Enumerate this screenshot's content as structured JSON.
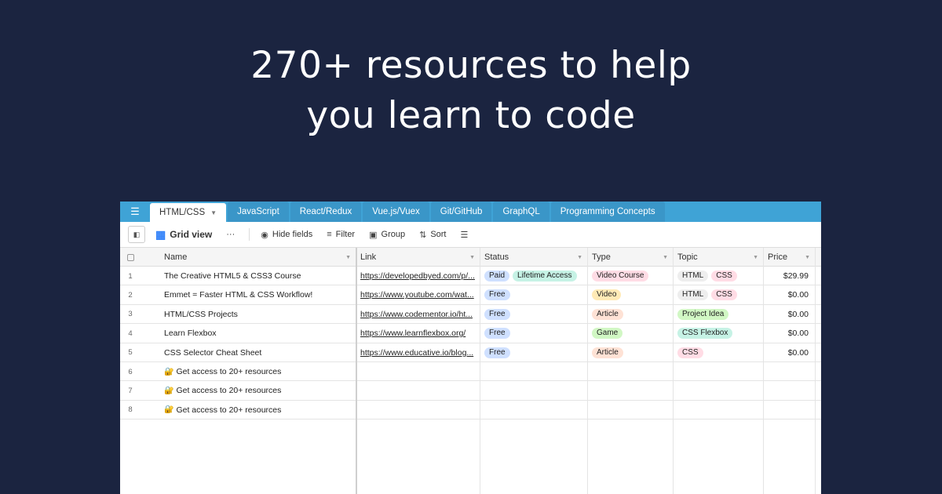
{
  "headline": {
    "line1": "270+ resources to help",
    "line2": "you learn to code"
  },
  "tabs": [
    {
      "label": "HTML/CSS",
      "active": true
    },
    {
      "label": "JavaScript"
    },
    {
      "label": "React/Redux"
    },
    {
      "label": "Vue.js/Vuex"
    },
    {
      "label": "Git/GitHub"
    },
    {
      "label": "GraphQL"
    },
    {
      "label": "Programming Concepts"
    }
  ],
  "toolbar": {
    "view_label": "Grid view",
    "more": "···",
    "hide_fields": "Hide fields",
    "filter": "Filter",
    "group": "Group",
    "sort": "Sort"
  },
  "columns": {
    "name": "Name",
    "link": "Link",
    "status": "Status",
    "type": "Type",
    "topic": "Topic",
    "price": "Price"
  },
  "rows": [
    {
      "num": "1",
      "name": "The Creative HTML5 & CSS3 Course",
      "link": "https://developedbyed.com/p/...",
      "status": [
        {
          "text": "Paid",
          "color": "#cfe0ff"
        },
        {
          "text": "Lifetime Access",
          "color": "#c6f2e5"
        }
      ],
      "type": [
        {
          "text": "Video Course",
          "color": "#ffdce5"
        }
      ],
      "topic": [
        {
          "text": "HTML",
          "color": "#eeeeee"
        },
        {
          "text": "CSS",
          "color": "#ffdce5"
        }
      ],
      "price": "$29.99"
    },
    {
      "num": "2",
      "name": "Emmet = Faster HTML & CSS Workflow!",
      "link": "https://www.youtube.com/wat...",
      "status": [
        {
          "text": "Free",
          "color": "#cfe0ff"
        }
      ],
      "type": [
        {
          "text": "Video",
          "color": "#ffeab6"
        }
      ],
      "topic": [
        {
          "text": "HTML",
          "color": "#eeeeee"
        },
        {
          "text": "CSS",
          "color": "#ffdce5"
        }
      ],
      "price": "$0.00"
    },
    {
      "num": "3",
      "name": "HTML/CSS Projects",
      "link": "https://www.codementor.io/ht...",
      "status": [
        {
          "text": "Free",
          "color": "#cfe0ff"
        }
      ],
      "type": [
        {
          "text": "Article",
          "color": "#fee2d5"
        }
      ],
      "topic": [
        {
          "text": "Project Idea",
          "color": "#d1f7c4"
        }
      ],
      "price": "$0.00"
    },
    {
      "num": "4",
      "name": "Learn Flexbox",
      "link": "https://www.learnflexbox.org/",
      "status": [
        {
          "text": "Free",
          "color": "#cfe0ff"
        }
      ],
      "type": [
        {
          "text": "Game",
          "color": "#d1f7c4"
        }
      ],
      "topic": [
        {
          "text": "CSS Flexbox",
          "color": "#c6f2e5"
        }
      ],
      "price": "$0.00"
    },
    {
      "num": "5",
      "name": "CSS Selector Cheat Sheet",
      "link": "https://www.educative.io/blog...",
      "status": [
        {
          "text": "Free",
          "color": "#cfe0ff"
        }
      ],
      "type": [
        {
          "text": "Article",
          "color": "#fee2d5"
        }
      ],
      "topic": [
        {
          "text": "CSS",
          "color": "#ffdce5"
        }
      ],
      "price": "$0.00"
    },
    {
      "num": "6",
      "name": "Get access to 20+ resources",
      "locked": true
    },
    {
      "num": "7",
      "name": "Get access to 20+ resources",
      "locked": true
    },
    {
      "num": "8",
      "name": "Get access to 20+ resources",
      "locked": true
    }
  ],
  "colors": {
    "background": "#1b2440",
    "tabbar": "#3fa3d6",
    "grid_icon": "#2d7ff9"
  }
}
